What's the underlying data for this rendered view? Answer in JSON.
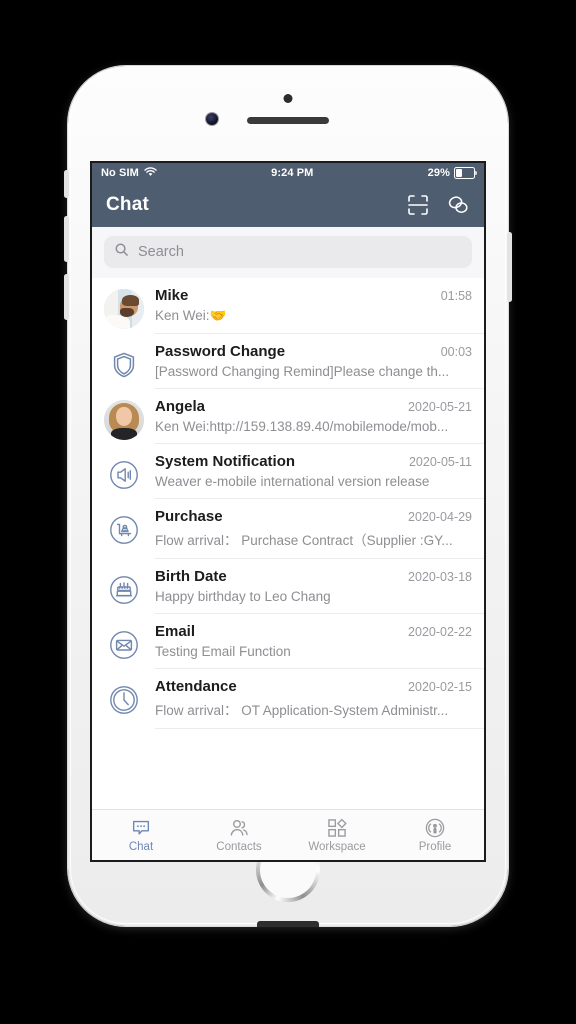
{
  "device": {
    "kind": "smartphone",
    "orientation": "portrait"
  },
  "status_bar": {
    "carrier": "No SIM",
    "wifi_icon": "wifi-icon",
    "time": "9:24 PM",
    "battery_text": "29%",
    "battery_percent": 29
  },
  "nav_bar": {
    "title": "Chat",
    "scan_icon": "scan-icon",
    "new_chat_icon": "chat-bubbles-icon"
  },
  "search": {
    "placeholder": "Search",
    "value": "",
    "icon": "search-icon"
  },
  "colors": {
    "header_bg": "#4F5D70",
    "accent": "#6E86B8",
    "icon_outline": "#7187AD",
    "search_bg": "#EAEAEC",
    "title_text": "#1C1C1E",
    "secondary_text": "#8E8E93",
    "separator": "#ECECEC"
  },
  "conversations": [
    {
      "id": "mike",
      "icon": "avatar-photo-mike",
      "avatar_type": "photo",
      "title": "Mike",
      "time": "01:58",
      "preview": "Ken Wei:🤝"
    },
    {
      "id": "password-change",
      "icon": "shield-icon",
      "avatar_type": "icon",
      "title": "Password Change",
      "time": "00:03",
      "preview": "[Password Changing Remind]Please change th..."
    },
    {
      "id": "angela",
      "icon": "avatar-photo-angela",
      "avatar_type": "photo",
      "title": "Angela",
      "time": "2020-05-21",
      "preview": "Ken Wei:http://159.138.89.40/mobilemode/mob..."
    },
    {
      "id": "system-notification",
      "icon": "megaphone-icon",
      "avatar_type": "icon",
      "title": "System Notification",
      "time": "2020-05-11",
      "preview": "Weaver e-mobile international version release"
    },
    {
      "id": "purchase",
      "icon": "shopping-cart-icon",
      "avatar_type": "icon",
      "title": "Purchase",
      "time": "2020-04-29",
      "preview": "Flow arrival：  Purchase Contract（Supplier :GY..."
    },
    {
      "id": "birth-date",
      "icon": "birthday-cake-icon",
      "avatar_type": "icon",
      "title": "Birth Date",
      "time": "2020-03-18",
      "preview": "Happy birthday to  Leo Chang"
    },
    {
      "id": "email",
      "icon": "envelope-icon",
      "avatar_type": "icon",
      "title": "Email",
      "time": "2020-02-22",
      "preview": "Testing Email Function"
    },
    {
      "id": "attendance",
      "icon": "clock-icon",
      "avatar_type": "icon",
      "title": "Attendance",
      "time": "2020-02-15",
      "preview": "Flow arrival：  OT Application-System Administr..."
    }
  ],
  "tab_bar": {
    "items": [
      {
        "id": "chat",
        "label": "Chat",
        "icon": "chat-bubble-dots-icon",
        "active": true
      },
      {
        "id": "contacts",
        "label": "Contacts",
        "icon": "people-icon",
        "active": false
      },
      {
        "id": "workspace",
        "label": "Workspace",
        "icon": "grid-shapes-icon",
        "active": false
      },
      {
        "id": "profile",
        "label": "Profile",
        "icon": "broadcast-person-icon",
        "active": false
      }
    ]
  }
}
